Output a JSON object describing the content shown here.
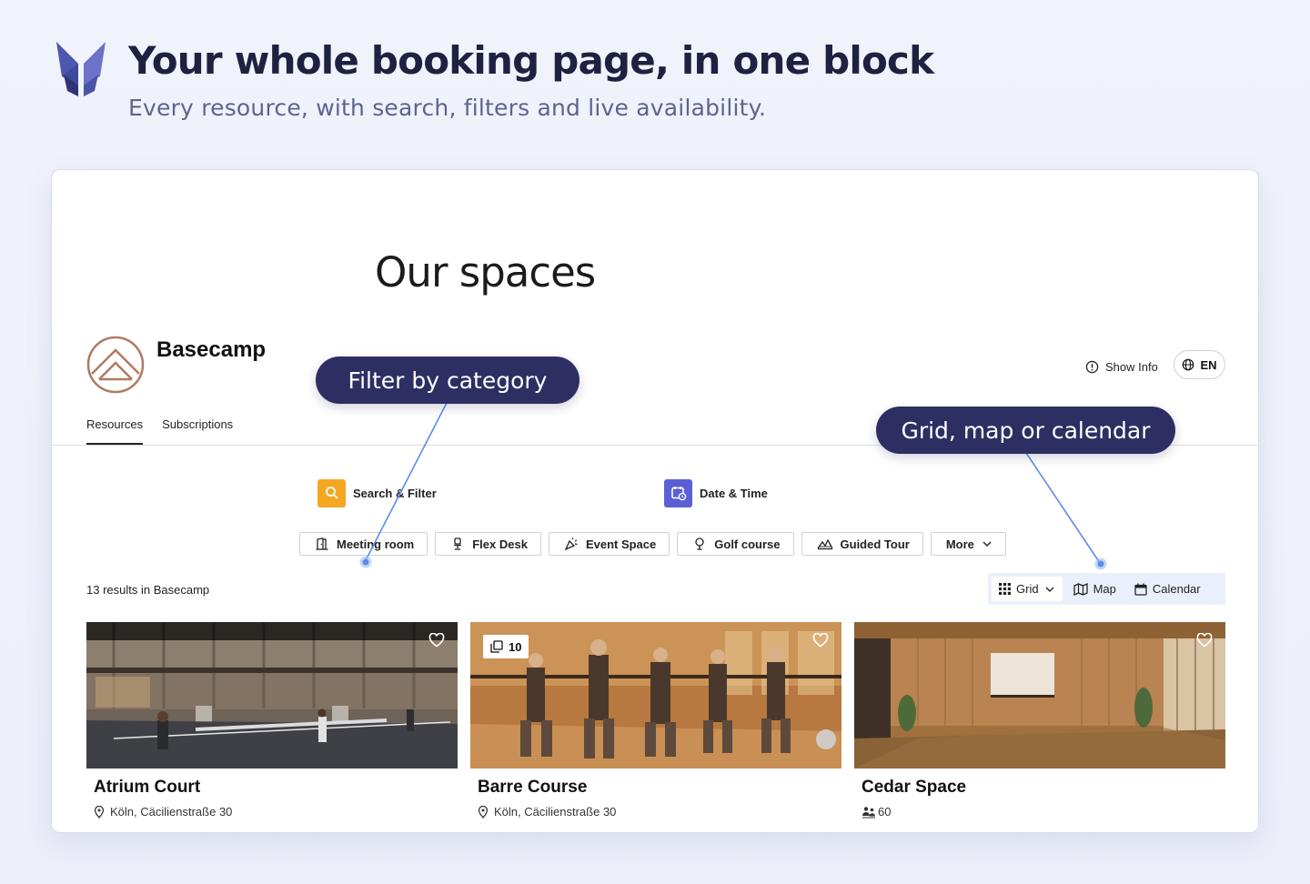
{
  "hero": {
    "title": "Your whole booking page, in one block",
    "subtitle": "Every resource, with search, filters and live availability.",
    "logo_icon": "butterfly-logo-icon"
  },
  "page": {
    "heading": "Our spaces"
  },
  "brand": {
    "name": "Basecamp",
    "logo_icon": "mountain-logo-icon"
  },
  "header_actions": {
    "show_info": "Show Info",
    "language": "EN"
  },
  "tabs": [
    {
      "label": "Resources",
      "active": true
    },
    {
      "label": "Subscriptions",
      "active": false
    }
  ],
  "search": {
    "search_filter_label": "Search & Filter",
    "date_time_label": "Date & Time",
    "search_icon_color": "#f5a623",
    "date_icon_color": "#5b5fd6"
  },
  "categories": [
    {
      "label": "Meeting room",
      "icon": "door-icon"
    },
    {
      "label": "Flex Desk",
      "icon": "desk-chair-icon"
    },
    {
      "label": "Event Space",
      "icon": "party-icon"
    },
    {
      "label": "Golf course",
      "icon": "golf-icon"
    },
    {
      "label": "Guided Tour",
      "icon": "mountain-icon"
    },
    {
      "label": "More",
      "icon": "chevron-down-icon"
    }
  ],
  "results": {
    "count_text": "13 results in Basecamp"
  },
  "view_modes": [
    {
      "label": "Grid",
      "icon": "grid-icon",
      "active": true
    },
    {
      "label": "Map",
      "icon": "map-icon",
      "active": false
    },
    {
      "label": "Calendar",
      "icon": "calendar-icon",
      "active": false
    }
  ],
  "resources": [
    {
      "title": "Atrium Court",
      "meta": "Köln, Cäcilienstraße 30",
      "meta_icon": "location-pin-icon"
    },
    {
      "title": "Barre Course",
      "meta": "Köln, Cäcilienstraße 30",
      "meta_icon": "location-pin-icon",
      "badge": "10"
    },
    {
      "title": "Cedar Space",
      "meta": "60",
      "meta_icon": "people-icon"
    }
  ],
  "callouts": {
    "filter": "Filter by category",
    "views": "Grid, map or calendar"
  },
  "colors": {
    "hero_title": "#1e2140",
    "hero_subtitle": "#5e6390",
    "callout_bg": "#2d2f63",
    "connector": "#5b8de8",
    "view_toggle_bg": "#eaf0fb",
    "brand_logo": "#b07a60"
  }
}
